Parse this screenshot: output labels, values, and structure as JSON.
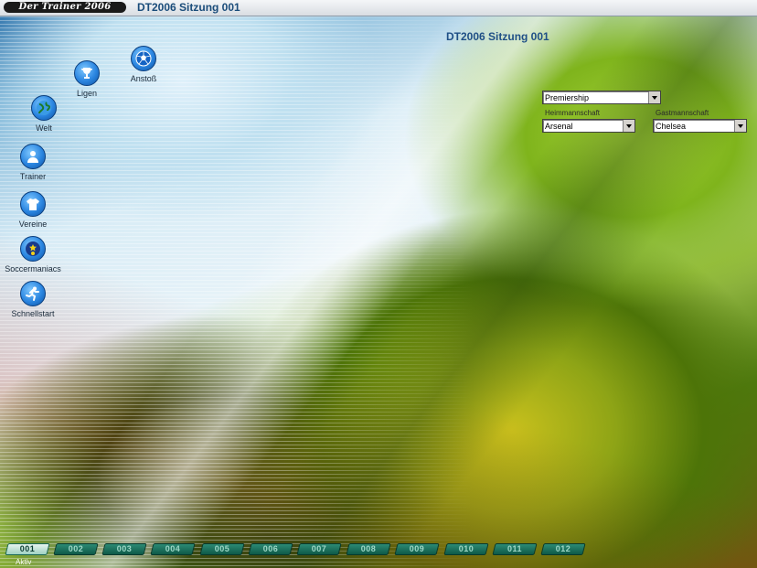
{
  "titlebar": {
    "logo": "Der Trainer 2006",
    "title": "DT2006 Sitzung 001"
  },
  "session_title": "DT2006 Sitzung 001",
  "desktop_icons": [
    {
      "label": "Ligen",
      "icon": "trophy-icon"
    },
    {
      "label": "Anstoß",
      "icon": "football-icon"
    },
    {
      "label": "Welt",
      "icon": "globe-icon"
    },
    {
      "label": "Trainer",
      "icon": "person-icon"
    },
    {
      "label": "Vereine",
      "icon": "jersey-icon"
    },
    {
      "label": "Soccermaniacs",
      "icon": "stars-icon"
    },
    {
      "label": "Schnellstart",
      "icon": "runner-icon"
    }
  ],
  "match_setup": {
    "league": "Premiership",
    "home_label": "Heimmannschaft",
    "home_team": "Arsenal",
    "away_label": "Gastmannschaft",
    "away_team": "Chelsea"
  },
  "session_tabs": [
    {
      "label": "001",
      "active": true
    },
    {
      "label": "002"
    },
    {
      "label": "003"
    },
    {
      "label": "004"
    },
    {
      "label": "005"
    },
    {
      "label": "006"
    },
    {
      "label": "007"
    },
    {
      "label": "008"
    },
    {
      "label": "009"
    },
    {
      "label": "010"
    },
    {
      "label": "011"
    },
    {
      "label": "012"
    }
  ],
  "active_tab_label": "Aktiv",
  "colors": {
    "tab": "#0e5a48",
    "title": "#1f4f86",
    "icon": "#2a85e0"
  }
}
